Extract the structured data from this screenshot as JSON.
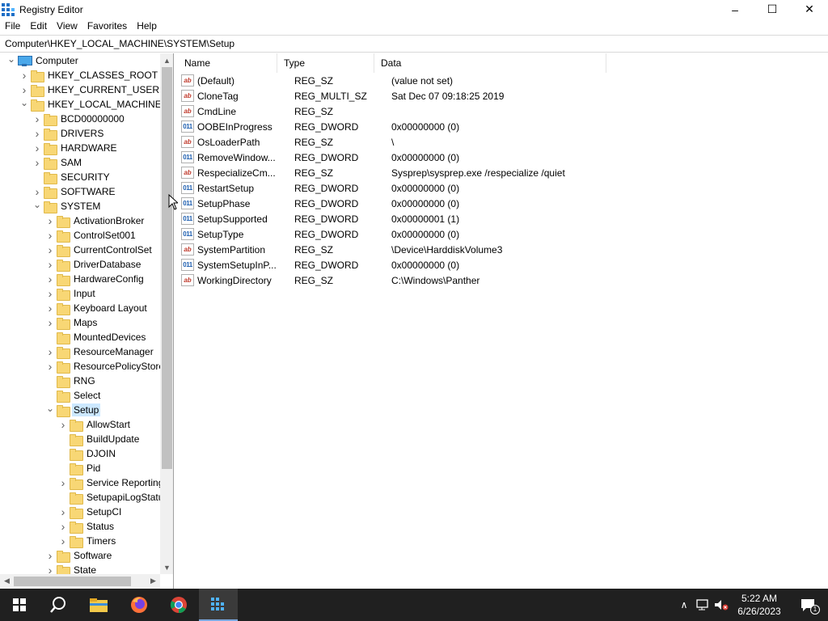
{
  "window": {
    "title": "Registry Editor",
    "minimize_glyph": "–",
    "maximize_glyph": "☐",
    "close_glyph": "✕"
  },
  "menu": [
    "File",
    "Edit",
    "View",
    "Favorites",
    "Help"
  ],
  "address": {
    "value": "Computer\\HKEY_LOCAL_MACHINE\\SYSTEM\\Setup"
  },
  "tree": [
    {
      "label": "Computer",
      "depth": 0,
      "expander": "open",
      "icon": "computer-icon"
    },
    {
      "label": "HKEY_CLASSES_ROOT",
      "depth": 1,
      "expander": "closed"
    },
    {
      "label": "HKEY_CURRENT_USER",
      "depth": 1,
      "expander": "closed"
    },
    {
      "label": "HKEY_LOCAL_MACHINE",
      "depth": 1,
      "expander": "open"
    },
    {
      "label": "BCD00000000",
      "depth": 2,
      "expander": "closed"
    },
    {
      "label": "DRIVERS",
      "depth": 2,
      "expander": "closed"
    },
    {
      "label": "HARDWARE",
      "depth": 2,
      "expander": "closed"
    },
    {
      "label": "SAM",
      "depth": 2,
      "expander": "closed"
    },
    {
      "label": "SECURITY",
      "depth": 2,
      "expander": "none"
    },
    {
      "label": "SOFTWARE",
      "depth": 2,
      "expander": "closed"
    },
    {
      "label": "SYSTEM",
      "depth": 2,
      "expander": "open"
    },
    {
      "label": "ActivationBroker",
      "depth": 3,
      "expander": "closed"
    },
    {
      "label": "ControlSet001",
      "depth": 3,
      "expander": "closed"
    },
    {
      "label": "CurrentControlSet",
      "depth": 3,
      "expander": "closed"
    },
    {
      "label": "DriverDatabase",
      "depth": 3,
      "expander": "closed"
    },
    {
      "label": "HardwareConfig",
      "depth": 3,
      "expander": "closed"
    },
    {
      "label": "Input",
      "depth": 3,
      "expander": "closed"
    },
    {
      "label": "Keyboard Layout",
      "depth": 3,
      "expander": "closed"
    },
    {
      "label": "Maps",
      "depth": 3,
      "expander": "closed"
    },
    {
      "label": "MountedDevices",
      "depth": 3,
      "expander": "none"
    },
    {
      "label": "ResourceManager",
      "depth": 3,
      "expander": "closed"
    },
    {
      "label": "ResourcePolicyStore",
      "depth": 3,
      "expander": "closed"
    },
    {
      "label": "RNG",
      "depth": 3,
      "expander": "none"
    },
    {
      "label": "Select",
      "depth": 3,
      "expander": "none"
    },
    {
      "label": "Setup",
      "depth": 3,
      "expander": "open",
      "selected": true
    },
    {
      "label": "AllowStart",
      "depth": 4,
      "expander": "closed"
    },
    {
      "label": "BuildUpdate",
      "depth": 4,
      "expander": "none"
    },
    {
      "label": "DJOIN",
      "depth": 4,
      "expander": "none"
    },
    {
      "label": "Pid",
      "depth": 4,
      "expander": "none"
    },
    {
      "label": "Service Reporting",
      "depth": 4,
      "expander": "closed"
    },
    {
      "label": "SetupapiLogStatu",
      "depth": 4,
      "expander": "none"
    },
    {
      "label": "SetupCI",
      "depth": 4,
      "expander": "closed"
    },
    {
      "label": "Status",
      "depth": 4,
      "expander": "closed"
    },
    {
      "label": "Timers",
      "depth": 4,
      "expander": "closed"
    },
    {
      "label": "Software",
      "depth": 3,
      "expander": "closed"
    },
    {
      "label": "State",
      "depth": 3,
      "expander": "closed"
    }
  ],
  "columns": {
    "name": "Name",
    "type": "Type",
    "data": "Data"
  },
  "values": [
    {
      "name": "(Default)",
      "type": "REG_SZ",
      "data": "(value not set)",
      "icon": "string"
    },
    {
      "name": "CloneTag",
      "type": "REG_MULTI_SZ",
      "data": "Sat Dec 07 09:18:25 2019",
      "icon": "string"
    },
    {
      "name": "CmdLine",
      "type": "REG_SZ",
      "data": "",
      "icon": "string"
    },
    {
      "name": "OOBEInProgress",
      "type": "REG_DWORD",
      "data": "0x00000000 (0)",
      "icon": "binary"
    },
    {
      "name": "OsLoaderPath",
      "type": "REG_SZ",
      "data": "\\",
      "icon": "string"
    },
    {
      "name": "RemoveWindow...",
      "type": "REG_DWORD",
      "data": "0x00000000 (0)",
      "icon": "binary"
    },
    {
      "name": "RespecializeCm...",
      "type": "REG_SZ",
      "data": "Sysprep\\sysprep.exe /respecialize /quiet",
      "icon": "string"
    },
    {
      "name": "RestartSetup",
      "type": "REG_DWORD",
      "data": "0x00000000 (0)",
      "icon": "binary"
    },
    {
      "name": "SetupPhase",
      "type": "REG_DWORD",
      "data": "0x00000000 (0)",
      "icon": "binary"
    },
    {
      "name": "SetupSupported",
      "type": "REG_DWORD",
      "data": "0x00000001 (1)",
      "icon": "binary"
    },
    {
      "name": "SetupType",
      "type": "REG_DWORD",
      "data": "0x00000000 (0)",
      "icon": "binary"
    },
    {
      "name": "SystemPartition",
      "type": "REG_SZ",
      "data": "\\Device\\HarddiskVolume3",
      "icon": "string"
    },
    {
      "name": "SystemSetupInP...",
      "type": "REG_DWORD",
      "data": "0x00000000 (0)",
      "icon": "binary"
    },
    {
      "name": "WorkingDirectory",
      "type": "REG_SZ",
      "data": "C:\\Windows\\Panther",
      "icon": "string"
    }
  ],
  "icon_glyphs": {
    "string": "ab",
    "binary": "011"
  },
  "taskbar": {
    "clock": {
      "time": "5:22 AM",
      "date": "6/26/2023"
    },
    "notification_count": "1"
  },
  "colors": {
    "selection": "#cce8ff",
    "folder": "#f8d775",
    "taskbar": "#202020"
  }
}
